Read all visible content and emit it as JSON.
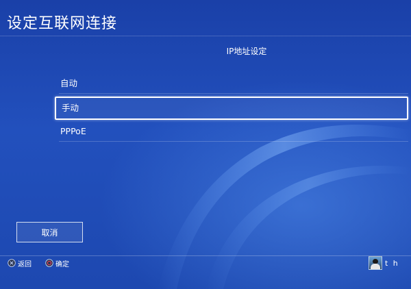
{
  "header": {
    "title": "设定互联网连接"
  },
  "section": {
    "title": "IP地址设定"
  },
  "options": [
    {
      "label": "自动",
      "selected": false
    },
    {
      "label": "手动",
      "selected": true
    },
    {
      "label": "PPPoE",
      "selected": false
    }
  ],
  "buttons": {
    "cancel_label": "取消"
  },
  "footer": {
    "back_label": "返回",
    "back_icon": "cross-button-icon",
    "confirm_label": "确定",
    "confirm_icon": "circle-button-icon",
    "user_name": "t h"
  },
  "colors": {
    "background": "#1d48b0",
    "text": "#ffffff",
    "circle_button": "#d0304a"
  }
}
